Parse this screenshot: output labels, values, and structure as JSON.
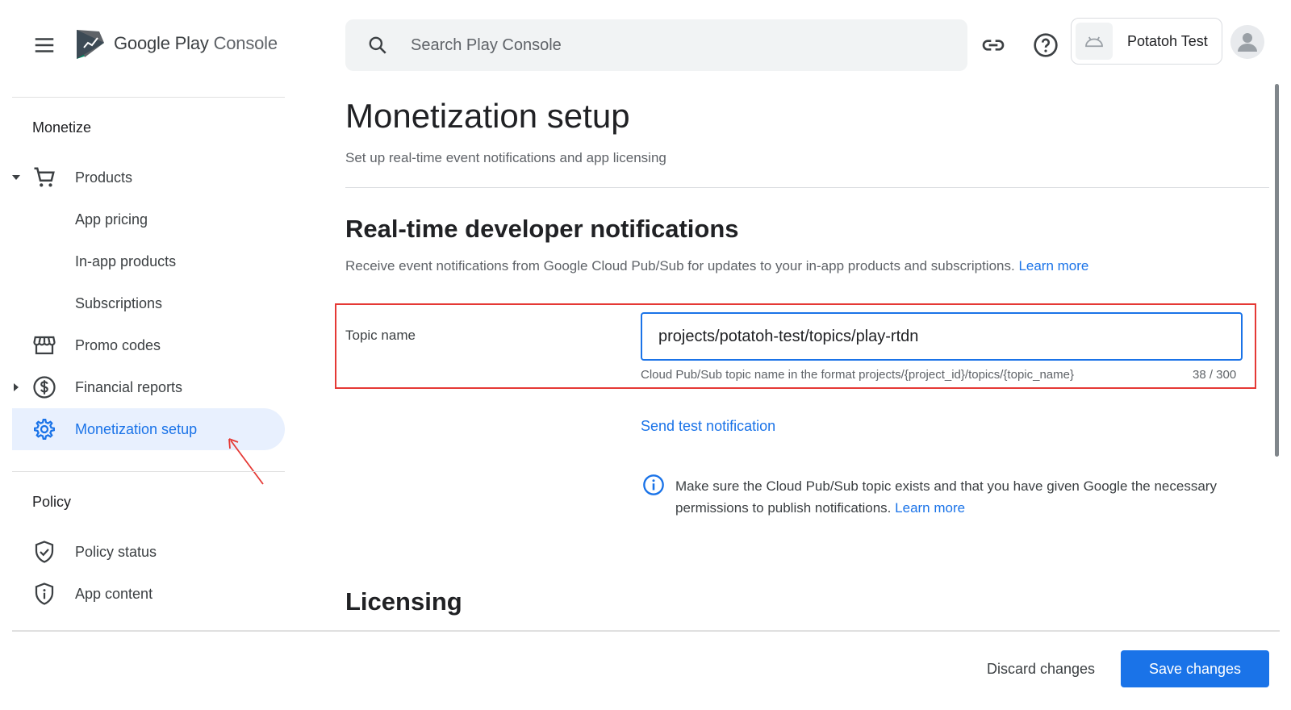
{
  "app": {
    "logo_brand": "Google Play",
    "logo_product": "Console"
  },
  "topbar": {
    "search_placeholder": "Search Play Console",
    "account_name": "Potatoh Test"
  },
  "sidebar": {
    "monetize_title": "Monetize",
    "policy_title": "Policy",
    "items": [
      {
        "label": "Products",
        "icon": "cart-icon",
        "expanded": true
      },
      {
        "label": "App pricing"
      },
      {
        "label": "In-app products"
      },
      {
        "label": "Subscriptions"
      },
      {
        "label": "Promo codes",
        "icon": "store-icon"
      },
      {
        "label": "Financial reports",
        "icon": "dollar-icon",
        "expanded": false
      },
      {
        "label": "Monetization setup",
        "icon": "gear-icon",
        "active": true
      },
      {
        "label": "Policy status",
        "icon": "shield-check-icon"
      },
      {
        "label": "App content",
        "icon": "shield-info-icon"
      }
    ]
  },
  "main": {
    "title": "Monetization setup",
    "subtitle": "Set up real-time event notifications and app licensing",
    "rtdn": {
      "heading": "Real-time developer notifications",
      "description": "Receive event notifications from Google Cloud Pub/Sub for updates to your in-app products and subscriptions.",
      "learn_more": "Learn more",
      "topic_label": "Topic name",
      "topic_value": "projects/potatoh-test/topics/play-rtdn",
      "helper": "Cloud Pub/Sub topic name in the format projects/{project_id}/topics/{topic_name}",
      "counter": "38 / 300",
      "send_test": "Send test notification",
      "info_text": "Make sure the Cloud Pub/Sub topic exists and that you have given Google the necessary permissions to publish notifications.",
      "info_learn_more": "Learn more"
    },
    "licensing_heading": "Licensing"
  },
  "footer": {
    "discard_label": "Discard changes",
    "save_label": "Save changes"
  },
  "colors": {
    "accent": "#1a73e8",
    "active_bg": "#e8f0fe",
    "highlight_border": "#e53935"
  }
}
